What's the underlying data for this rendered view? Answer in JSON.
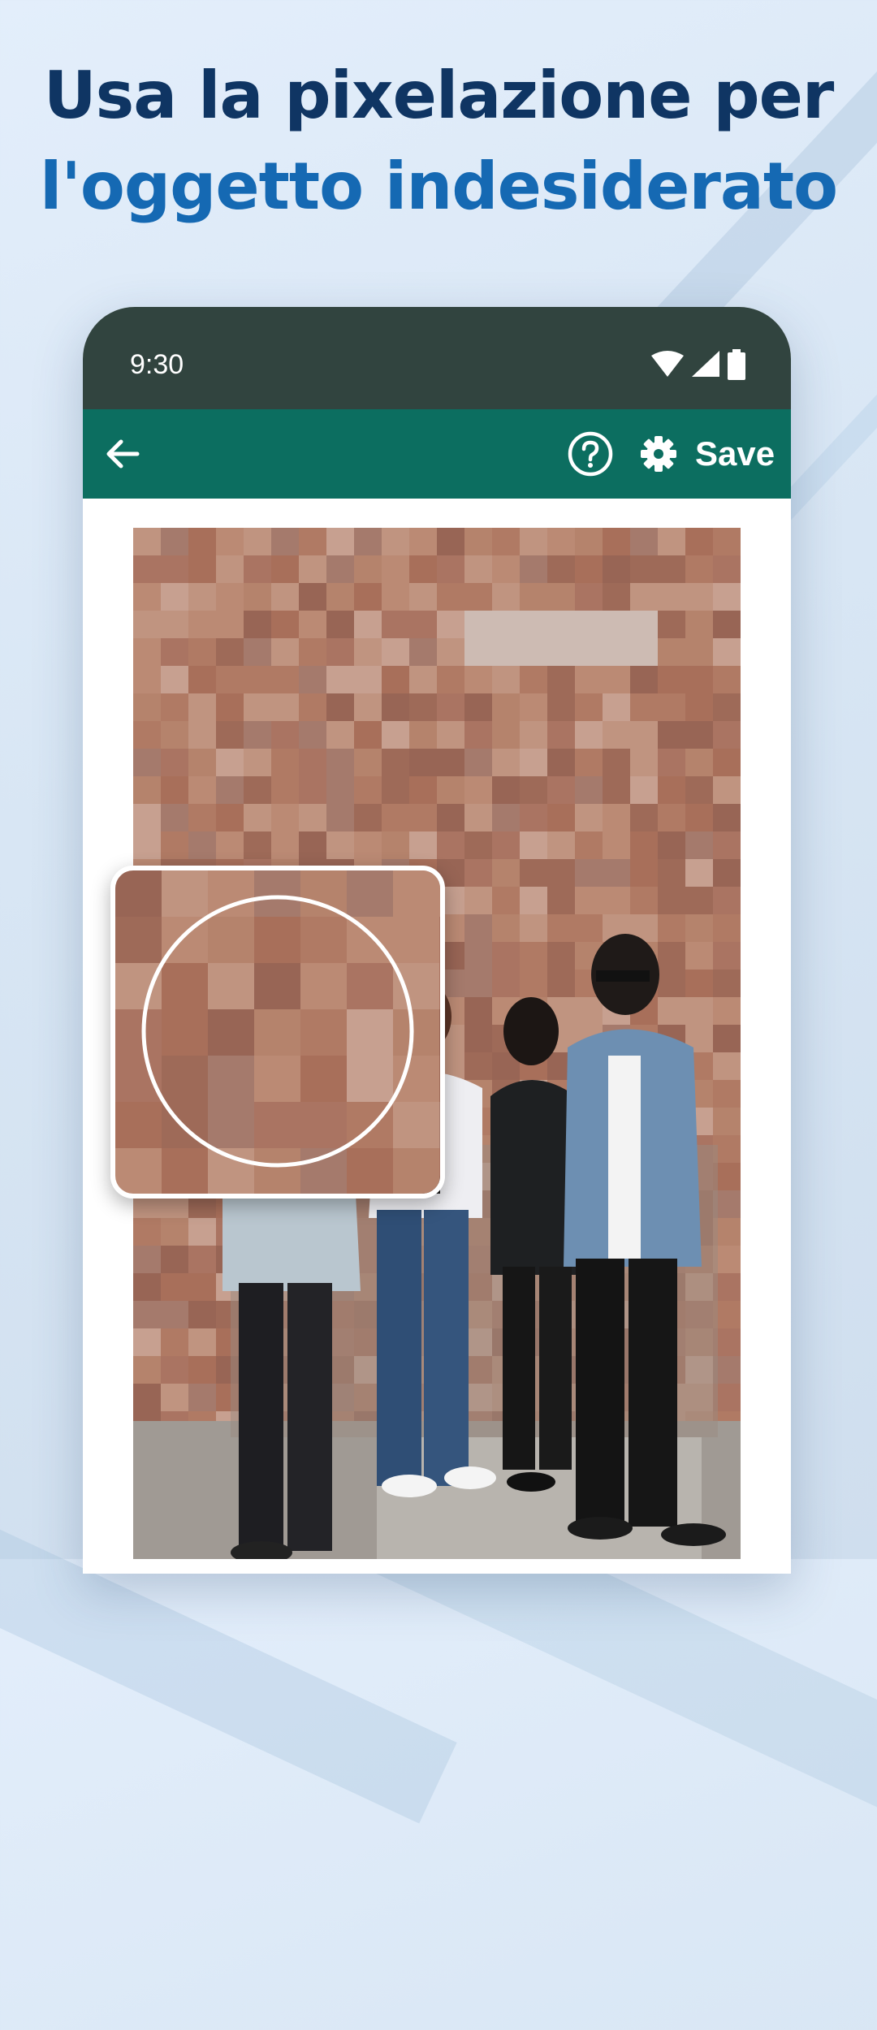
{
  "headline": {
    "line1": "Usa la pixelazione per",
    "line2": "l'oggetto indesiderato"
  },
  "status_bar": {
    "time": "9:30",
    "icons": [
      "wifi-icon",
      "signal-icon",
      "battery-icon"
    ]
  },
  "app_bar": {
    "back_icon": "arrow-left-icon",
    "help_icon": "help-circle-icon",
    "settings_icon": "gear-icon",
    "save_label": "Save"
  },
  "editor": {
    "image_description_icon": "pixelated-photo",
    "magnifier_icon": "zoom-loupe"
  },
  "colors": {
    "status_bar": "#31443f",
    "app_bar": "#0c6e60",
    "headline_dark": "#0f3563",
    "headline_accent": "#1569b3"
  }
}
